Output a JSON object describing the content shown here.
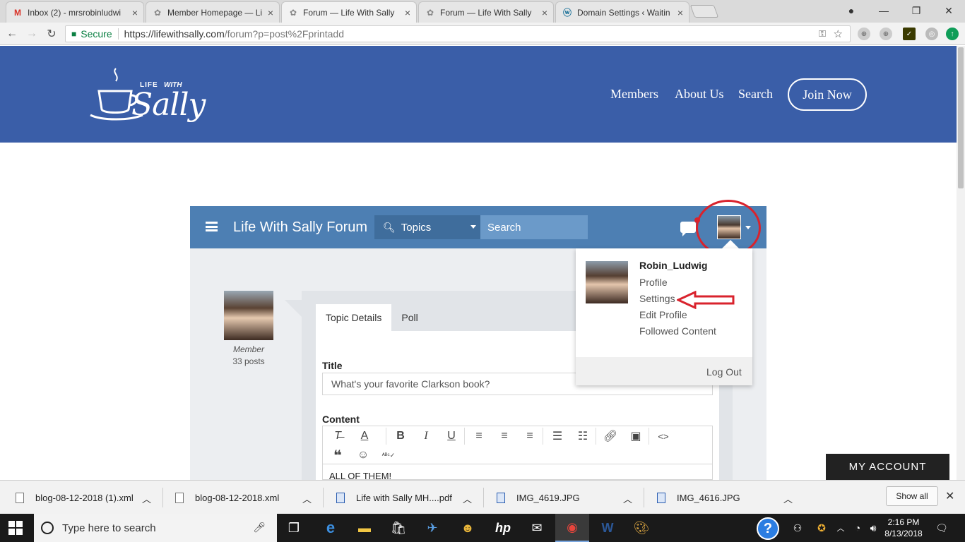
{
  "browser": {
    "tabs": [
      {
        "title": "Inbox (2) - mrsrobinludwi",
        "icon": "gmail-icon"
      },
      {
        "title": "Member Homepage — Li",
        "icon": "page-icon"
      },
      {
        "title": "Forum — Life With Sally",
        "icon": "page-icon",
        "active": true
      },
      {
        "title": "Forum — Life With Sally",
        "icon": "page-icon"
      },
      {
        "title": "Domain Settings ‹ Waitin",
        "icon": "wordpress-icon"
      }
    ],
    "secure_label": "Secure",
    "url_host": "https://lifewithsally.com",
    "url_path": "/forum?p=post%2Fprintadd"
  },
  "site": {
    "brand_colors": {
      "header": "#3a5ea8",
      "forum_bar": "#4d7fb3"
    },
    "logo_life": "LIFE",
    "logo_with": "WITH",
    "logo_sally": "Sally",
    "nav": [
      "Members",
      "About Us",
      "Search"
    ],
    "join_label": "Join Now"
  },
  "forum": {
    "title": "Life With Sally Forum",
    "topics_label": "Topics",
    "search_placeholder": "Search",
    "post": {
      "role": "Member",
      "posts": "33 posts",
      "tabs": [
        "Topic Details",
        "Poll"
      ],
      "title_label": "Title",
      "title_value": "What's your favorite Clarkson book?",
      "content_label": "Content",
      "content_text": "ALL OF THEM!"
    },
    "dropdown": {
      "username": "Robin_Ludwig",
      "items": [
        "Profile",
        "Settings",
        "Edit Profile",
        "Followed Content"
      ],
      "logout": "Log Out"
    },
    "annotation_color": "#d9232d"
  },
  "my_account_label": "MY ACCOUNT",
  "downloads": {
    "items": [
      "blog-08-12-2018 (1).xml",
      "blog-08-12-2018.xml",
      "Life with Sally MH....pdf",
      "IMG_4619.JPG",
      "IMG_4616.JPG"
    ],
    "show_all": "Show all"
  },
  "taskbar": {
    "search_placeholder": "Type here to search",
    "time": "2:16 PM",
    "date": "8/13/2018"
  }
}
